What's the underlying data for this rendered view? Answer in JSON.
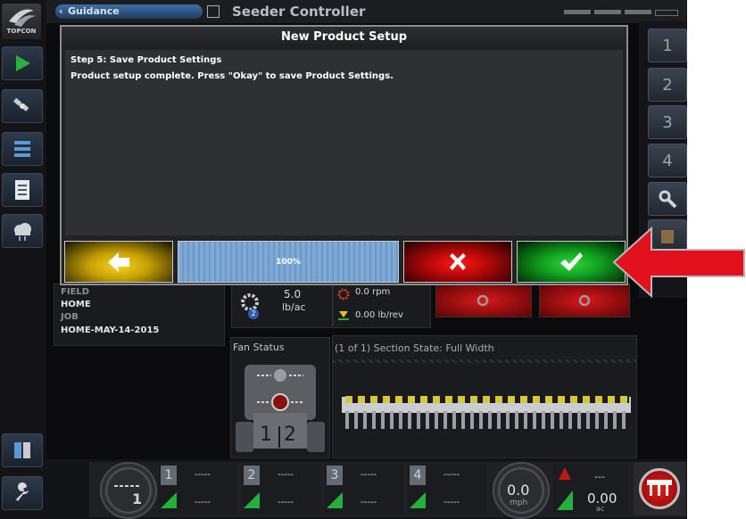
{
  "brand": {
    "logo_text": "TOPCON"
  },
  "header": {
    "guidance_label": "Guidance",
    "title": "Seeder Controller"
  },
  "right_tools": {
    "sections": [
      "1",
      "2",
      "3",
      "4"
    ]
  },
  "field_panel": {
    "field_label": "FIELD",
    "field_value": "HOME",
    "job_label": "JOB",
    "job_value": "HOME-MAY-14-2015"
  },
  "product_panel": {
    "badge": "2",
    "rate": "5.0",
    "rate_unit": "lb/ac",
    "rpm": "0.0 rpm",
    "lb_rev": "0.00 lb/rev"
  },
  "fan_panel": {
    "title": "Fan Status",
    "gauge_left": "1",
    "gauge_right": "2"
  },
  "section_panel": {
    "title": "(1 of 1) Section State: Full Width"
  },
  "dialog": {
    "title": "New Product Setup",
    "step": "Step 5: Save Product Settings",
    "message": "Product setup complete. Press \"Okay\" to save Product Settings.",
    "progress_label": "100%",
    "progress_value": 1.0
  },
  "bottom_bar": {
    "left_gauge_num": "1",
    "segments": [
      {
        "num": "1",
        "top": "-----",
        "bottom": "-----"
      },
      {
        "num": "2",
        "top": "-----",
        "bottom": "-----"
      },
      {
        "num": "3",
        "top": "-----",
        "bottom": "-----"
      },
      {
        "num": "4",
        "top": "-----",
        "bottom": "-----"
      }
    ],
    "speed": "0.0",
    "speed_unit": "mph",
    "area_top": "---",
    "area_value": "0.00",
    "area_unit": "ac"
  },
  "colors": {
    "accent_blue": "#3f6ea6",
    "back_yellow": "#f3cf1c",
    "cancel_red": "#d80e0e",
    "okay_green": "#21b832",
    "arrow_red": "#e3101d"
  }
}
